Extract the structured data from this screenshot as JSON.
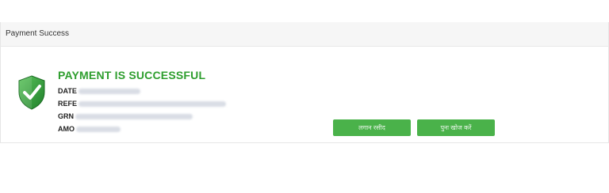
{
  "panel": {
    "header_title": "Payment Success"
  },
  "result": {
    "title": "PAYMENT IS SUCCESSFUL",
    "fields": [
      {
        "label": "DATE"
      },
      {
        "label": "REFE"
      },
      {
        "label": "GRN"
      },
      {
        "label": "AMO"
      }
    ]
  },
  "actions": {
    "print_label": "लगान रसीद",
    "search_label": "पुनः खोज करें"
  },
  "colors": {
    "accent_green": "#2e9e2e",
    "button_green": "#4ab24a"
  }
}
